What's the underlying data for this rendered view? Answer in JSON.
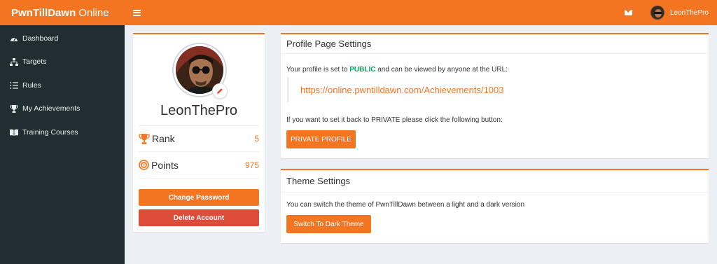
{
  "brand": {
    "bold": "PwnTillDawn",
    "light": "Online"
  },
  "topbar": {
    "username": "LeonThePro"
  },
  "sidebar": {
    "items": [
      {
        "label": "Dashboard",
        "icon": "dashboard-icon"
      },
      {
        "label": "Targets",
        "icon": "sitemap-icon"
      },
      {
        "label": "Rules",
        "icon": "list-icon"
      },
      {
        "label": "My Achievements",
        "icon": "trophy-icon"
      },
      {
        "label": "Training Courses",
        "icon": "book-icon"
      }
    ]
  },
  "profile": {
    "username": "LeonThePro",
    "rank_label": "Rank",
    "rank_value": "5",
    "points_label": "Points",
    "points_value": "975",
    "change_password_label": "Change Password",
    "delete_account_label": "Delete Account"
  },
  "profile_settings": {
    "title": "Profile Page Settings",
    "status_prefix": "Your profile is set to ",
    "status_value": "PUBLIC",
    "status_suffix": " and can be viewed by anyone at the URL:",
    "url": "https://online.pwntilldawn.com/Achievements/1003",
    "private_prompt": "If you want to set it back to PRIVATE please click the following button:",
    "private_button": "PRIVATE PROFILE"
  },
  "theme_settings": {
    "title": "Theme Settings",
    "text": "You can switch the theme of PwnTillDawn between a light and a dark version",
    "button": "Switch To Dark Theme"
  },
  "colors": {
    "accent": "#f47521",
    "sidebar": "#222d32",
    "danger": "#dd4b39",
    "success": "#00a65a"
  }
}
